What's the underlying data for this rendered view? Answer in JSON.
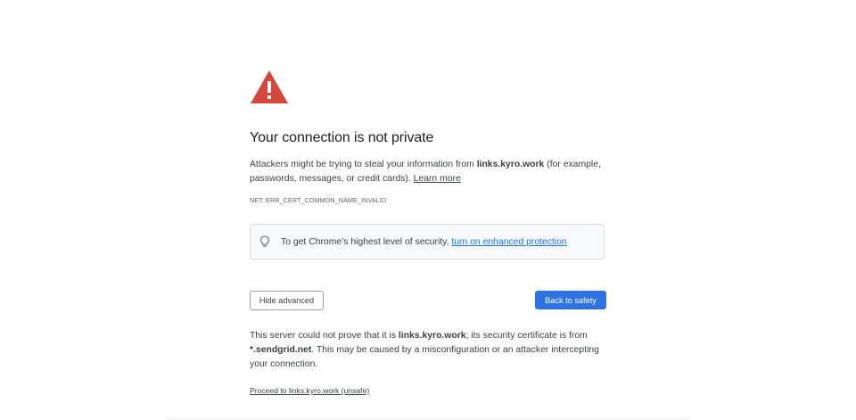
{
  "page": {
    "title": "Your connection is not private",
    "explanation": {
      "prefix": "Attackers might be trying to steal your information from ",
      "domain": "links.kyro.work",
      "suffix": " (for example, passwords, messages, or credit cards). ",
      "learn_more": "Learn more"
    },
    "error_code": "NET::ERR_CERT_COMMON_NAME_INVALID",
    "enhanced": {
      "text": "To get Chrome’s highest level of security, ",
      "link": "turn on enhanced protection"
    },
    "buttons": {
      "hide_advanced": "Hide advanced",
      "back_to_safety": "Back to safety"
    },
    "details": {
      "part1": "This server could not prove that it is ",
      "domain": "links.kyro.work",
      "part2": "; its security certificate is from ",
      "cert_domain": "*.sendgrid.net",
      "part3": ". This may be caused by a misconfiguration or an attacker intercepting your connection."
    },
    "proceed_link": "Proceed to links.kyro.work (unsafe)"
  },
  "icons": {
    "warning": "warning-triangle-icon",
    "bulb": "lightbulb-icon"
  },
  "colors": {
    "warning_red": "#d3473c",
    "primary_blue": "#2f72e1",
    "link_blue": "#1a73e8"
  }
}
